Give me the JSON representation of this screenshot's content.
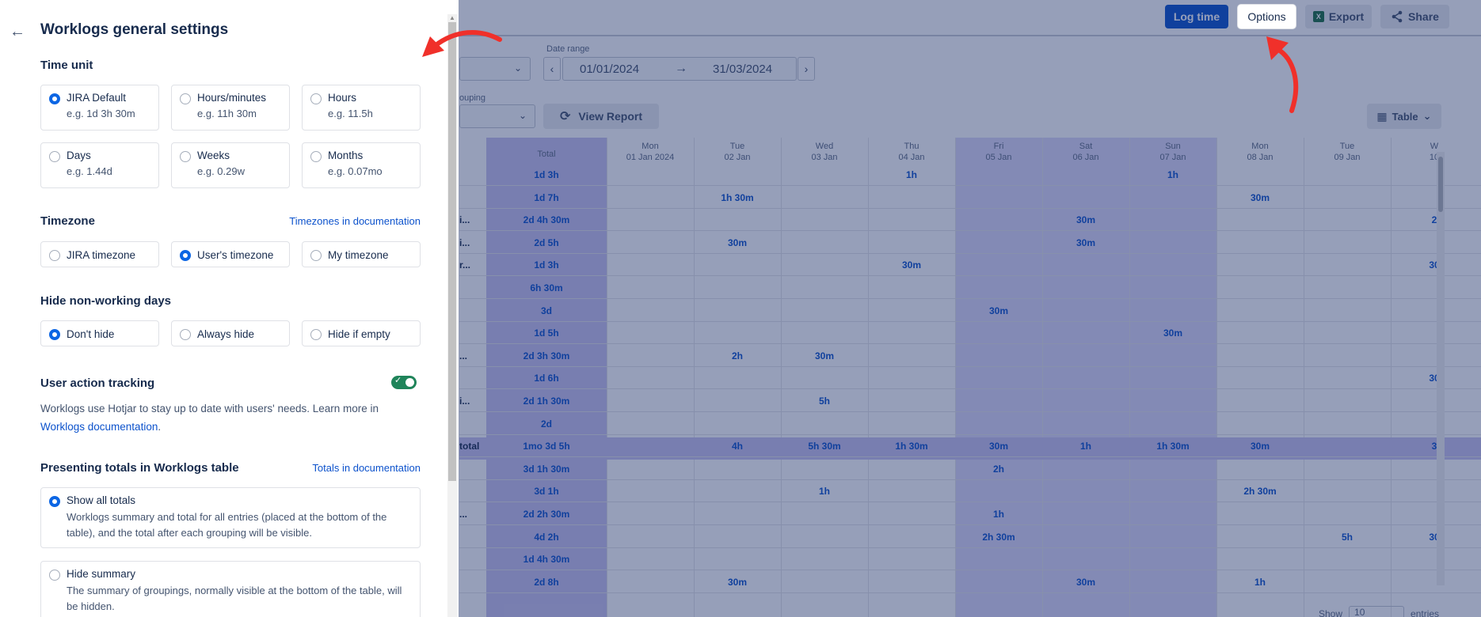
{
  "toolbar": {
    "log_time": "Log time",
    "options": "Options",
    "export": "Export",
    "share": "Share"
  },
  "filters": {
    "date_range_label": "Date range",
    "date_from": "01/01/2024",
    "date_to": "31/03/2024",
    "grouping_label": "ouping",
    "view_report": "View Report",
    "table": "Table"
  },
  "grid": {
    "total_header": "Total",
    "days": [
      {
        "d": "Mon",
        "date": "01 Jan 2024"
      },
      {
        "d": "Tue",
        "date": "02 Jan"
      },
      {
        "d": "Wed",
        "date": "03 Jan"
      },
      {
        "d": "Thu",
        "date": "04 Jan"
      },
      {
        "d": "Fri",
        "date": "05 Jan"
      },
      {
        "d": "Sat",
        "date": "06 Jan"
      },
      {
        "d": "Sun",
        "date": "07 Jan"
      },
      {
        "d": "Mon",
        "date": "08 Jan"
      },
      {
        "d": "Tue",
        "date": "09 Jan"
      },
      {
        "d": "W",
        "date": "10"
      }
    ],
    "row_labels": [
      "",
      "",
      "i...",
      "i...",
      "r...",
      "",
      "",
      "",
      "...",
      "",
      "i...",
      "",
      "total",
      "",
      "",
      "...",
      "",
      "",
      ""
    ],
    "totals": [
      "1d 3h",
      "1d 7h",
      "2d 4h 30m",
      "2d 5h",
      "1d 3h",
      "6h 30m",
      "3d",
      "1d 5h",
      "2d 3h 30m",
      "1d 6h",
      "2d 1h 30m",
      "2d",
      "1mo 3d 5h",
      "3d 1h 30m",
      "3d 1h",
      "2d 2h 30m",
      "4d 2h",
      "1d 4h 30m",
      "2d 8h"
    ],
    "cells": [
      [
        "",
        "",
        "",
        "1h",
        "",
        "",
        "1h",
        "",
        "",
        ""
      ],
      [
        "",
        "1h 30m",
        "",
        "",
        "",
        "",
        "",
        "30m",
        "",
        ""
      ],
      [
        "",
        "",
        "",
        "",
        "",
        "30m",
        "",
        "",
        "",
        "2"
      ],
      [
        "",
        "30m",
        "",
        "",
        "",
        "30m",
        "",
        "",
        "",
        ""
      ],
      [
        "",
        "",
        "",
        "30m",
        "",
        "",
        "",
        "",
        "",
        "30"
      ],
      [
        "",
        "",
        "",
        "",
        "",
        "",
        "",
        "",
        "",
        ""
      ],
      [
        "",
        "",
        "",
        "",
        "30m",
        "",
        "",
        "",
        "",
        ""
      ],
      [
        "",
        "",
        "",
        "",
        "",
        "",
        "30m",
        "",
        "",
        ""
      ],
      [
        "",
        "2h",
        "30m",
        "",
        "",
        "",
        "",
        "",
        "",
        ""
      ],
      [
        "",
        "",
        "",
        "",
        "",
        "",
        "",
        "",
        "",
        "30"
      ],
      [
        "",
        "",
        "5h",
        "",
        "",
        "",
        "",
        "",
        "",
        ""
      ],
      [
        "",
        "",
        "",
        "",
        "",
        "",
        "",
        "",
        "",
        ""
      ],
      [
        "",
        "4h",
        "5h 30m",
        "1h 30m",
        "30m",
        "1h",
        "1h 30m",
        "30m",
        "",
        "3"
      ],
      [
        "",
        "",
        "",
        "",
        "2h",
        "",
        "",
        "",
        "",
        ""
      ],
      [
        "",
        "",
        "1h",
        "",
        "",
        "",
        "",
        "2h 30m",
        "",
        ""
      ],
      [
        "",
        "",
        "",
        "",
        "1h",
        "",
        "",
        "",
        "",
        ""
      ],
      [
        "",
        "",
        "",
        "",
        "2h 30m",
        "",
        "",
        "",
        "5h",
        "30"
      ],
      [
        "",
        "",
        "",
        "",
        "",
        "",
        "",
        "",
        "",
        ""
      ],
      [
        "",
        "30m",
        "",
        "",
        "",
        "30m",
        "",
        "1h",
        "",
        ""
      ]
    ],
    "pager_show": "Show",
    "pager_value": "10",
    "pager_entries": "entries"
  },
  "panel": {
    "title": "Worklogs general settings",
    "time_unit": {
      "title": "Time unit",
      "options": [
        {
          "label": "JIRA Default",
          "example": "e.g. 1d 3h 30m",
          "selected": true
        },
        {
          "label": "Hours/minutes",
          "example": "e.g. 11h 30m",
          "selected": false
        },
        {
          "label": "Hours",
          "example": "e.g. 11.5h",
          "selected": false
        },
        {
          "label": "Days",
          "example": "e.g. 1.44d",
          "selected": false
        },
        {
          "label": "Weeks",
          "example": "e.g. 0.29w",
          "selected": false
        },
        {
          "label": "Months",
          "example": "e.g. 0.07mo",
          "selected": false
        }
      ]
    },
    "timezone": {
      "title": "Timezone",
      "link": "Timezones in documentation",
      "options": [
        {
          "label": "JIRA timezone",
          "selected": false
        },
        {
          "label": "User's timezone",
          "selected": true
        },
        {
          "label": "My timezone",
          "selected": false
        }
      ]
    },
    "non_working": {
      "title": "Hide non-working days",
      "options": [
        {
          "label": "Don't hide",
          "selected": true
        },
        {
          "label": "Always hide",
          "selected": false
        },
        {
          "label": "Hide if empty",
          "selected": false
        }
      ]
    },
    "tracking": {
      "title": "User action tracking",
      "enabled": true,
      "text": "Worklogs use Hotjar to stay up to date with users' needs. Learn more in",
      "link": "Worklogs documentation",
      "suffix": "."
    },
    "totals": {
      "title": "Presenting totals in Worklogs table",
      "link": "Totals in documentation",
      "options": [
        {
          "label": "Show all totals",
          "desc": "Worklogs summary and total for all entries (placed at the bottom of the table), and the total after each grouping will be visible.",
          "selected": true
        },
        {
          "label": "Hide summary",
          "desc": "The summary of groupings, normally visible at the bottom of the table, will be hidden.",
          "selected": false
        }
      ]
    }
  },
  "colors": {
    "accent": "#0c66e4",
    "primary_button": "#0c52cc",
    "toggle_on": "#1f845a",
    "annotation_arrow": "#f0302a"
  }
}
